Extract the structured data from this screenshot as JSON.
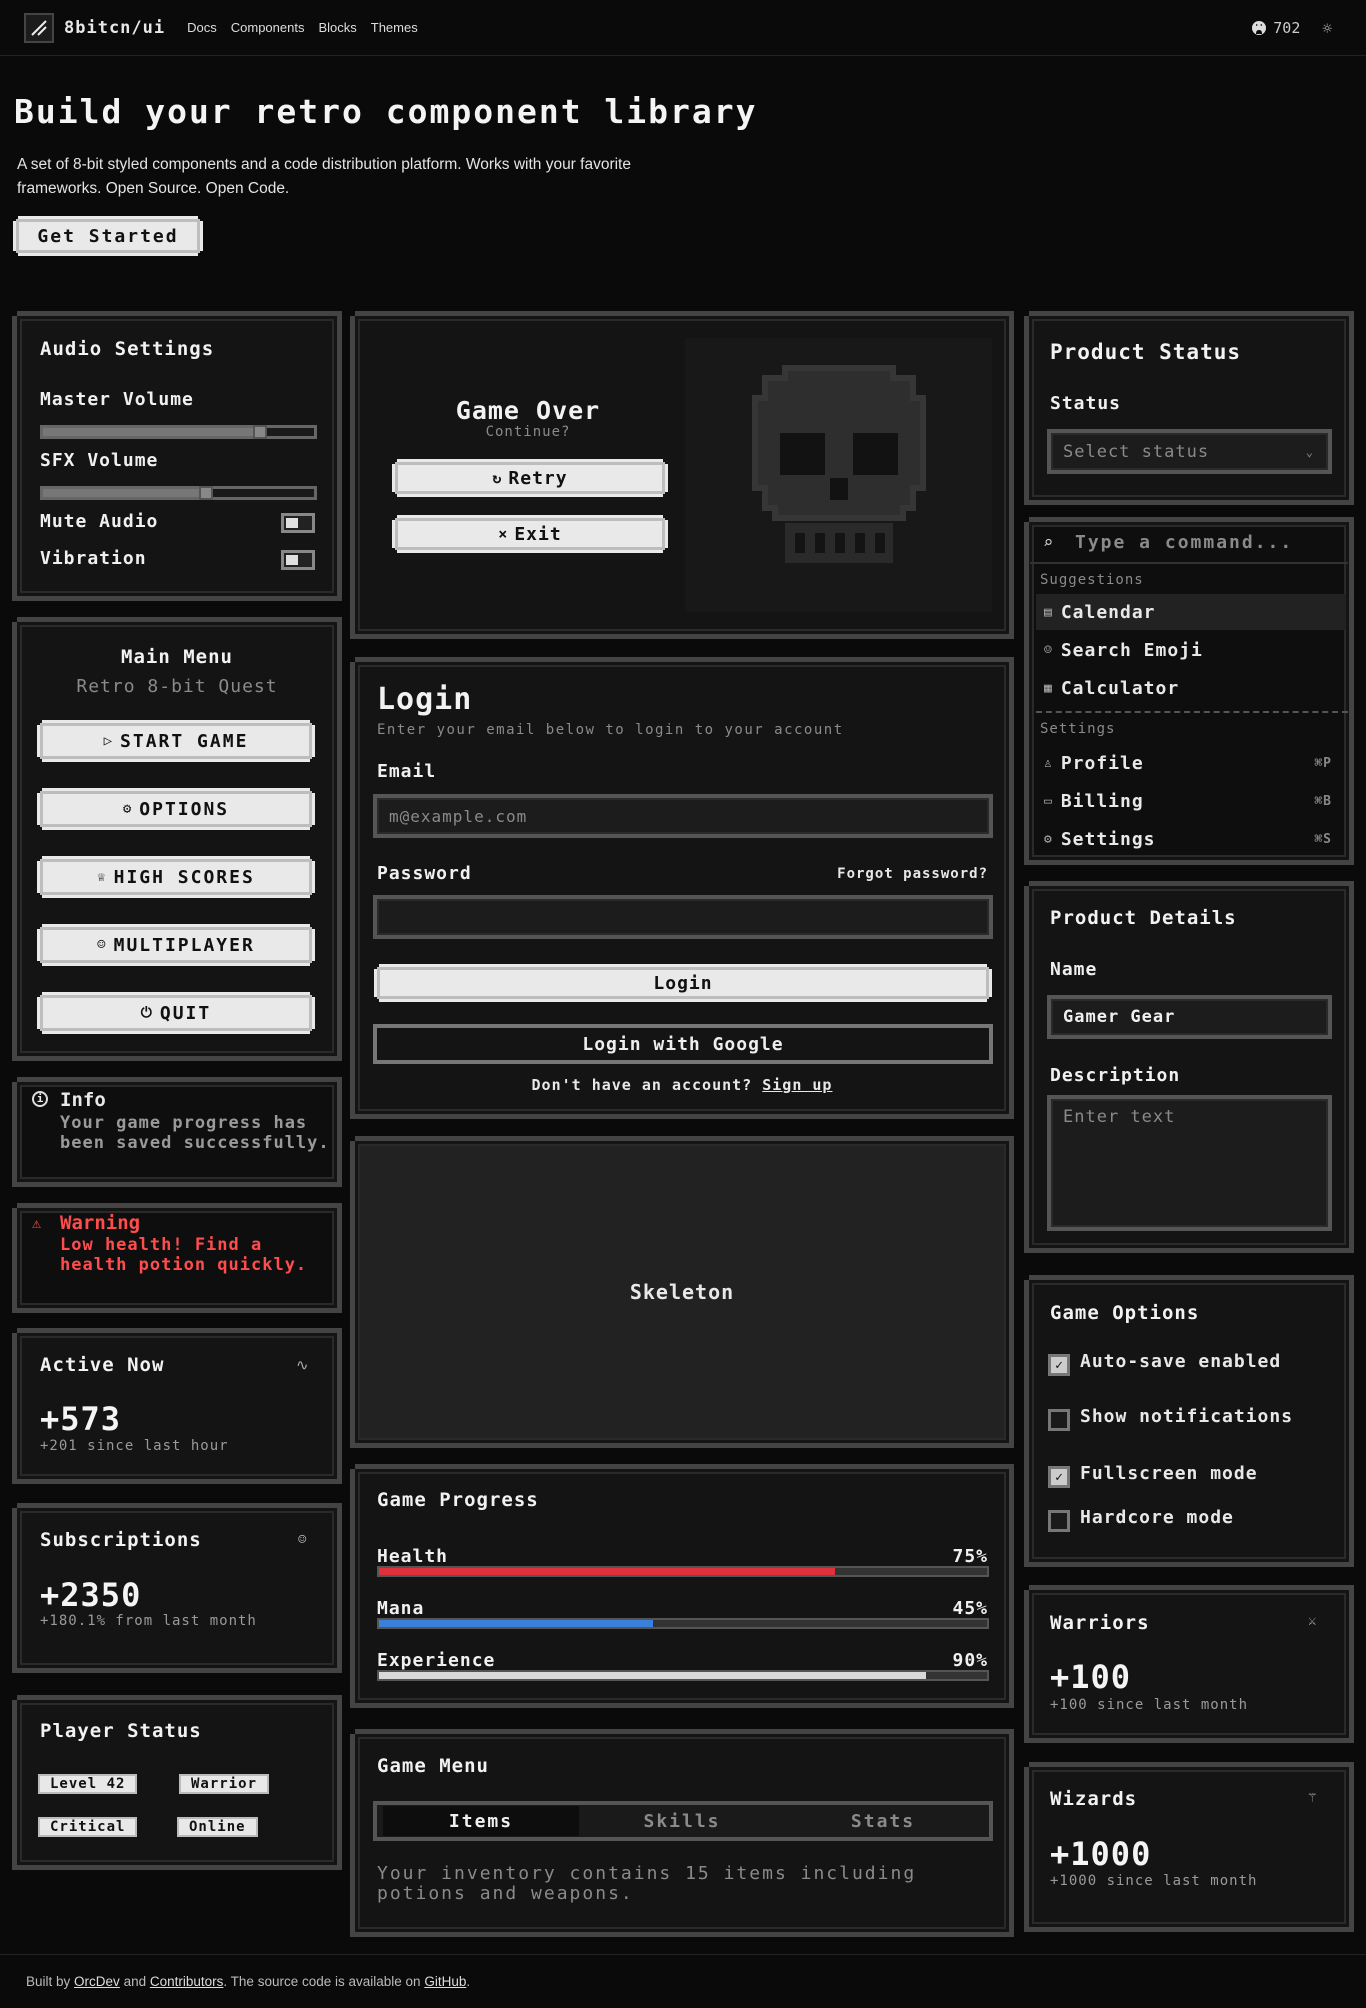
{
  "header": {
    "brand": "8bitcn/ui",
    "nav": [
      "Docs",
      "Components",
      "Blocks",
      "Themes"
    ],
    "github_stars": "702"
  },
  "hero": {
    "title": "Build your retro component library",
    "description": "A set of 8-bit styled components and a code distribution platform. Works with your favorite frameworks. Open Source. Open Code.",
    "cta": "Get Started"
  },
  "audio": {
    "title": "Audio Settings",
    "master_label": "Master Volume",
    "master_value": 0.8,
    "sfx_label": "SFX Volume",
    "sfx_value": 0.6,
    "mute_label": "Mute Audio",
    "vibration_label": "Vibration"
  },
  "main_menu": {
    "title": "Main Menu",
    "subtitle": "Retro 8-bit Quest",
    "items": [
      {
        "label": "START GAME",
        "icon": "play-icon"
      },
      {
        "label": "OPTIONS",
        "icon": "gear-icon"
      },
      {
        "label": "HIGH SCORES",
        "icon": "trophy-icon"
      },
      {
        "label": "MULTIPLAYER",
        "icon": "users-icon"
      },
      {
        "label": "QUIT",
        "icon": "power-icon"
      }
    ]
  },
  "info_alert": {
    "title": "Info",
    "body": "Your game progress has been saved successfully."
  },
  "warning_alert": {
    "title": "Warning",
    "body": "Low health! Find a health potion quickly.",
    "color": "#ff4d4d"
  },
  "active_now": {
    "title": "Active Now",
    "value": "+573",
    "note": "+201 since last hour"
  },
  "subscriptions": {
    "title": "Subscriptions",
    "value": "+2350",
    "note": "+180.1% from last month"
  },
  "player_status": {
    "title": "Player Status",
    "badges": [
      "Level 42",
      "Warrior",
      "Critical",
      "Online"
    ]
  },
  "game_over": {
    "title": "Game Over",
    "subtitle": "Continue?",
    "retry": "Retry",
    "exit": "Exit"
  },
  "login": {
    "title": "Login",
    "subtitle": "Enter your email below to login to your account",
    "email_label": "Email",
    "email_placeholder": "m@example.com",
    "password_label": "Password",
    "forgot": "Forgot password?",
    "login_btn": "Login",
    "google_btn": "Login with Google",
    "no_account": "Don't have an account?",
    "signup": "Sign up"
  },
  "skeleton": {
    "label": "Skeleton"
  },
  "game_progress": {
    "title": "Game Progress",
    "bars": [
      {
        "label": "Health",
        "value": 75,
        "display": "75%",
        "color": "#e0303a"
      },
      {
        "label": "Mana",
        "value": 45,
        "display": "45%",
        "color": "#3b7fdc"
      },
      {
        "label": "Experience",
        "value": 90,
        "display": "90%",
        "color": "#d9d9d9"
      }
    ]
  },
  "game_menu": {
    "title": "Game Menu",
    "tabs": [
      "Items",
      "Skills",
      "Stats"
    ],
    "active_tab": "Items",
    "content": "Your inventory contains 15 items including potions and weapons."
  },
  "product_status": {
    "title": "Product Status",
    "label": "Status",
    "placeholder": "Select status"
  },
  "command": {
    "placeholder": "Type a command...",
    "suggestions_heading": "Suggestions",
    "suggestions": [
      {
        "label": "Calendar",
        "icon": "calendar-icon"
      },
      {
        "label": "Search Emoji",
        "icon": "smile-icon"
      },
      {
        "label": "Calculator",
        "icon": "calculator-icon"
      }
    ],
    "settings_heading": "Settings",
    "settings": [
      {
        "label": "Profile",
        "icon": "user-icon",
        "shortcut": "⌘P"
      },
      {
        "label": "Billing",
        "icon": "card-icon",
        "shortcut": "⌘B"
      },
      {
        "label": "Settings",
        "icon": "gear-icon",
        "shortcut": "⌘S"
      }
    ]
  },
  "product_details": {
    "title": "Product Details",
    "name_label": "Name",
    "name_value": "Gamer Gear",
    "desc_label": "Description",
    "desc_placeholder": "Enter text"
  },
  "game_options": {
    "title": "Game Options",
    "options": [
      {
        "label": "Auto-save enabled",
        "checked": true
      },
      {
        "label": "Show notifications",
        "checked": false
      },
      {
        "label": "Fullscreen mode",
        "checked": true
      },
      {
        "label": "Hardcore mode",
        "checked": false
      }
    ]
  },
  "warriors": {
    "title": "Warriors",
    "value": "+100",
    "note": "+100 since last month"
  },
  "wizards": {
    "title": "Wizards",
    "value": "+1000",
    "note": "+1000 since last month"
  },
  "footer": {
    "prefix": "Built by",
    "author": "OrcDev",
    "and": "and",
    "contributors": "Contributors",
    "mid": ". The source code is available on",
    "github": "GitHub",
    "end": "."
  }
}
